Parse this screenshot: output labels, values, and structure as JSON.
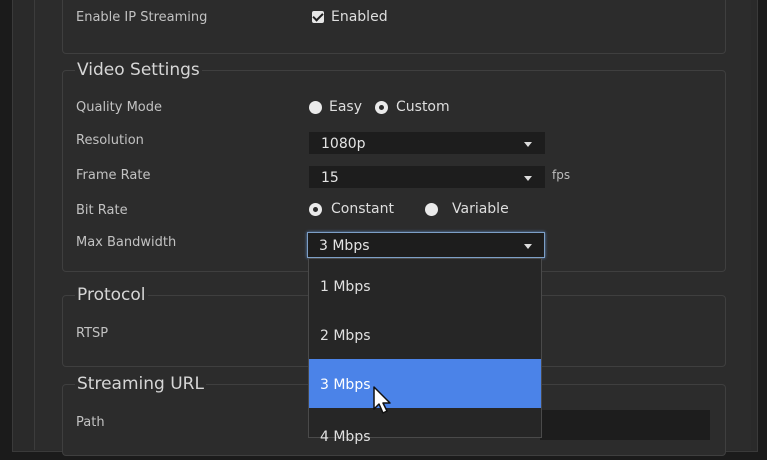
{
  "ip_streaming": {
    "label": "Enable IP Streaming",
    "checkbox_label": "Enabled",
    "checked": true
  },
  "video_settings": {
    "legend": "Video Settings",
    "quality_mode": {
      "label": "Quality Mode",
      "options": [
        "Easy",
        "Custom"
      ],
      "selected": "Custom"
    },
    "resolution": {
      "label": "Resolution",
      "value": "1080p"
    },
    "frame_rate": {
      "label": "Frame Rate",
      "value": "15",
      "unit": "fps"
    },
    "bit_rate": {
      "label": "Bit Rate",
      "options": [
        "Constant",
        "Variable"
      ],
      "selected": "Constant"
    },
    "max_bandwidth": {
      "label": "Max Bandwidth",
      "value": "3 Mbps"
    }
  },
  "protocol": {
    "legend": "Protocol",
    "label": "RTSP"
  },
  "streaming_url": {
    "legend": "Streaming URL",
    "path_label": "Path"
  },
  "bandwidth_dropdown": {
    "options": [
      "1 Mbps",
      "2 Mbps",
      "3 Mbps",
      "4 Mbps"
    ],
    "highlighted": "3 Mbps"
  },
  "colors": {
    "accent": "#4b83e8",
    "background": "#2c2c2c",
    "focus": "#7d9fc6"
  },
  "icons": {
    "checkbox": "checkmark-icon",
    "select_caret": "chevron-down-icon",
    "pointer": "mouse-pointer-icon"
  }
}
